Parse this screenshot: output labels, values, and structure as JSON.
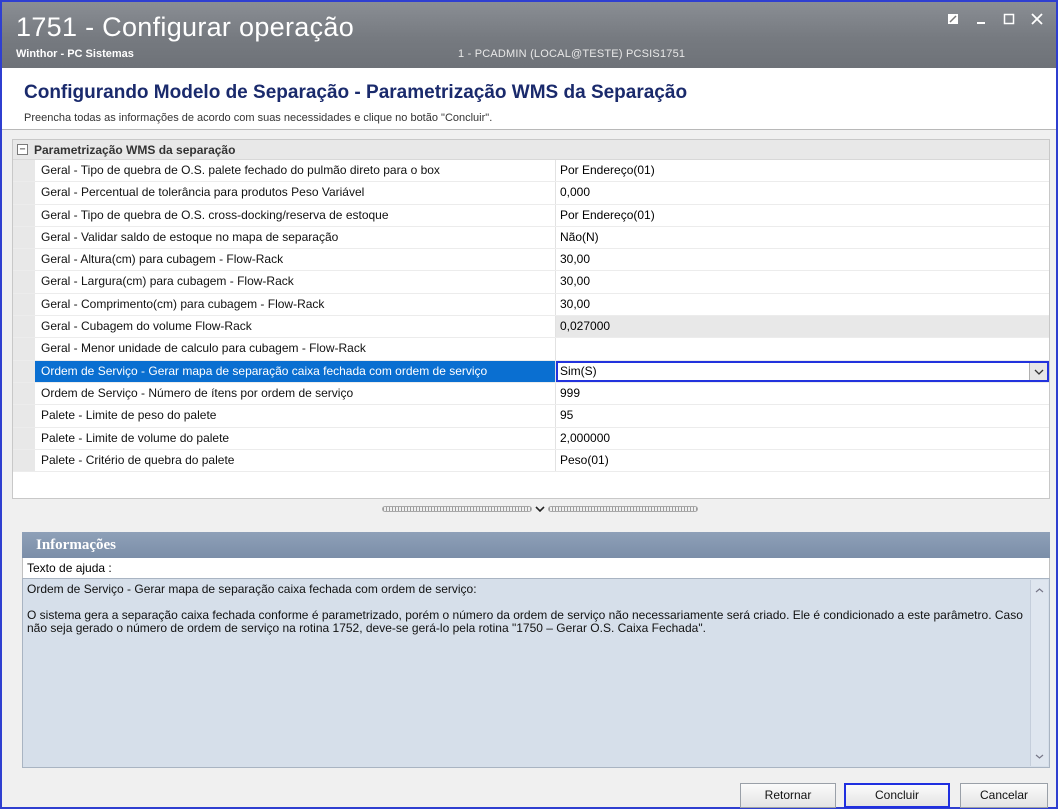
{
  "window": {
    "title": "1751 - Configurar operação",
    "subtitle": "Winthor - PC Sistemas",
    "user_info": "1 - PCADMIN (LOCAL@TESTE)   PCSIS1751"
  },
  "header": {
    "title": "Configurando Modelo de Separação - Parametrização WMS da Separação",
    "description": "Preencha todas as informações de acordo com suas necessidades e clique no botão \"Concluir\"."
  },
  "grid": {
    "category": "Parametrização WMS da separação",
    "rows": [
      {
        "name": "Geral - Tipo de quebra de O.S. palete fechado do pulmão direto para o box",
        "value": "Por Endereço(01)"
      },
      {
        "name": "Geral - Percentual de tolerância para produtos Peso Variável",
        "value": "0,000"
      },
      {
        "name": "Geral - Tipo de quebra de O.S. cross-docking/reserva de estoque",
        "value": "Por Endereço(01)"
      },
      {
        "name": "Geral - Validar saldo de estoque no mapa de separação",
        "value": "Não(N)"
      },
      {
        "name": "Geral - Altura(cm) para cubagem - Flow-Rack",
        "value": "30,00"
      },
      {
        "name": "Geral - Largura(cm) para cubagem - Flow-Rack",
        "value": "30,00"
      },
      {
        "name": "Geral - Comprimento(cm) para cubagem - Flow-Rack",
        "value": "30,00"
      },
      {
        "name": "Geral - Cubagem do volume Flow-Rack",
        "value": "0,027000"
      },
      {
        "name": "Geral - Menor unidade de calculo para cubagem - Flow-Rack",
        "value": ""
      },
      {
        "name": "Ordem de Serviço - Gerar mapa de separação caixa fechada com ordem de serviço",
        "value": "Sim(S)"
      },
      {
        "name": "Ordem de Serviço - Número de ítens por ordem de serviço",
        "value": "999"
      },
      {
        "name": "Palete - Limite de peso do palete",
        "value": "95"
      },
      {
        "name": "Palete - Limite de volume do palete",
        "value": "2,000000"
      },
      {
        "name": "Palete - Critério de quebra do palete",
        "value": "Peso(01)"
      }
    ]
  },
  "info": {
    "title": "Informações",
    "help_label": "Texto de ajuda :",
    "help_heading": "Ordem de Serviço - Gerar mapa de separação caixa fechada com ordem de serviço:",
    "help_body": "O sistema gera a separação caixa fechada conforme é parametrizado, porém o número da ordem de serviço não necessariamente será criado. Ele é condicionado a este parâmetro. Caso não seja gerado o número de ordem de serviço na rotina 1752, deve-se gerá-lo pela rotina \"1750 – Gerar O.S. Caixa Fechada\"."
  },
  "buttons": {
    "back": "Retornar",
    "finish": "Concluir",
    "cancel": "Cancelar"
  },
  "icons": {
    "restore": "restore-icon",
    "minimize": "minimize-icon",
    "maximize": "maximize-icon",
    "close": "close-icon",
    "collapse": "collapse-icon",
    "dropdown": "chevron-down-icon"
  }
}
